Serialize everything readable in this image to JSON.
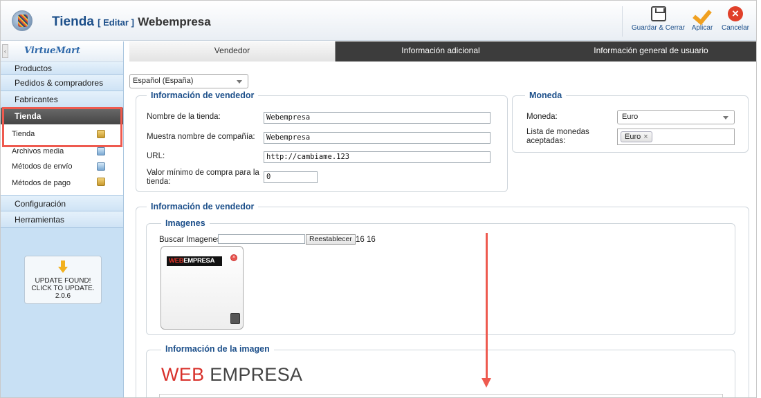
{
  "header": {
    "title": "Tienda",
    "edit_label": "[ Editar ]",
    "store_name": "Webempresa",
    "toolbar": {
      "save_close": "Guardar & Cerrar",
      "apply": "Aplicar",
      "cancel": "Cancelar"
    }
  },
  "sidebar": {
    "logo": "VirtueMart",
    "items_top": [
      "Productos",
      "Pedidos & compradores",
      "Fabricantes"
    ],
    "active": "Tienda",
    "subitems": [
      {
        "label": "Tienda",
        "icon": "store-icon"
      },
      {
        "label": "Archivos media",
        "icon": "media-icon"
      },
      {
        "label": "Métodos de envío",
        "icon": "truck-icon"
      },
      {
        "label": "Métodos de pago",
        "icon": "payment-icon"
      }
    ],
    "items_bottom": [
      "Configuración",
      "Herramientas"
    ],
    "update": {
      "line1": "UPDATE FOUND!",
      "line2": "CLICK TO UPDATE.",
      "version": "2.0.6"
    }
  },
  "tabs": [
    "Vendedor",
    "Información adicional",
    "Información general de usuario"
  ],
  "language_select": "Español (España)",
  "vendor_info": {
    "legend": "Información de vendedor",
    "fields": [
      {
        "label": "Nombre de la tienda:",
        "value": "Webempresa"
      },
      {
        "label": "Muestra nombre de compañía:",
        "value": "Webempresa"
      },
      {
        "label": "URL:",
        "value": "http://cambiame.123"
      },
      {
        "label": "Valor mínimo de compra para la tienda:",
        "value": "0"
      }
    ]
  },
  "currency": {
    "legend": "Moneda",
    "currency_label": "Moneda:",
    "currency_value": "Euro",
    "accepted_label": "Lista de monedas aceptadas:",
    "accepted_tag": "Euro"
  },
  "vendor_info2": {
    "legend": "Información de vendedor",
    "images_legend": "Imagenes",
    "search_label": "Buscar Imagenes :",
    "reset_button": "Reestablecer",
    "count": "16 16",
    "thumb_brand_red": "WEB",
    "thumb_brand_white": "EMPRESA",
    "image_info_legend": "Información de la imagen",
    "brand_red": "WEB",
    "brand_dark": "EMPRESA"
  },
  "colors": {
    "accent": "#1c4f8a",
    "highlight": "#ee5a4f",
    "sidebar_bg": "#c8e0f4",
    "tab_dark": "#3c3c3c"
  }
}
